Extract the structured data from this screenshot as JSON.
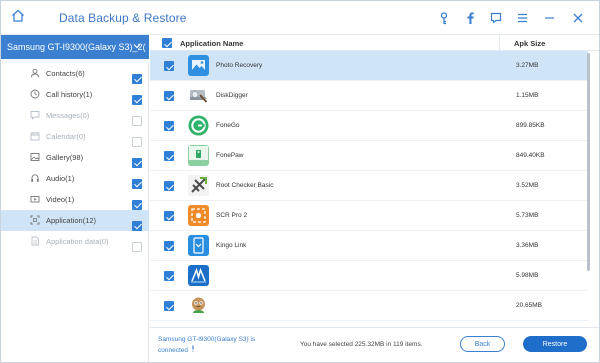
{
  "app": {
    "title": "Data Backup & Restore"
  },
  "colors": {
    "accent": "#3b7fd1",
    "selected_row": "#cfe5f7",
    "checkbox": "#2f7fd6"
  },
  "titlebar_icons": [
    "home-icon",
    "key-icon",
    "facebook-icon",
    "feedback-icon",
    "menu-icon",
    "minimize-icon",
    "close-icon"
  ],
  "device": {
    "name": "Samsung GT-I9300(Galaxy S3)_2("
  },
  "categories": [
    {
      "label": "Contacts(6)",
      "icon": "contacts-icon",
      "checked": true,
      "enabled": true
    },
    {
      "label": "Call history(1)",
      "icon": "call-history-icon",
      "checked": true,
      "enabled": true
    },
    {
      "label": "Messages(0)",
      "icon": "messages-icon",
      "checked": false,
      "enabled": false
    },
    {
      "label": "Calendar(0)",
      "icon": "calendar-icon",
      "checked": false,
      "enabled": false
    },
    {
      "label": "Gallery(98)",
      "icon": "gallery-icon",
      "checked": true,
      "enabled": true
    },
    {
      "label": "Audio(1)",
      "icon": "audio-icon",
      "checked": true,
      "enabled": true
    },
    {
      "label": "Video(1)",
      "icon": "video-icon",
      "checked": true,
      "enabled": true
    },
    {
      "label": "Application(12)",
      "icon": "application-icon",
      "checked": true,
      "enabled": true,
      "selected": true
    },
    {
      "label": "Application data(0)",
      "icon": "application-data-icon",
      "checked": false,
      "enabled": false
    }
  ],
  "table": {
    "headers": {
      "name": "Application Name",
      "size": "Apk Size"
    },
    "rows": [
      {
        "name": "Photo Recovery",
        "size": "3.27MB",
        "icon": "photo-recovery-icon",
        "selected": true
      },
      {
        "name": "DiskDigger",
        "size": "1.15MB",
        "icon": "diskdigger-icon"
      },
      {
        "name": "FoneGo",
        "size": "899.85KB",
        "icon": "fonego-icon"
      },
      {
        "name": "FonePaw",
        "size": "849.40KB",
        "icon": "fonepaw-icon"
      },
      {
        "name": "Root Checker Basic",
        "size": "3.52MB",
        "icon": "root-checker-icon"
      },
      {
        "name": "SCR Pro 2",
        "size": "5.73MB",
        "icon": "scr-pro-icon"
      },
      {
        "name": "Kingo Link",
        "size": "3.36MB",
        "icon": "kingo-link-icon"
      },
      {
        "name": "",
        "size": "5.98MB",
        "icon": "app-icon"
      },
      {
        "name": "",
        "size": "20.65MB",
        "icon": "android-app-icon"
      }
    ]
  },
  "footer": {
    "connection": "Samsung GT-I9300(Galaxy S3) is connected",
    "summary": "You have selected 225.32MB in 119 items.",
    "back_label": "Back",
    "restore_label": "Restore"
  }
}
